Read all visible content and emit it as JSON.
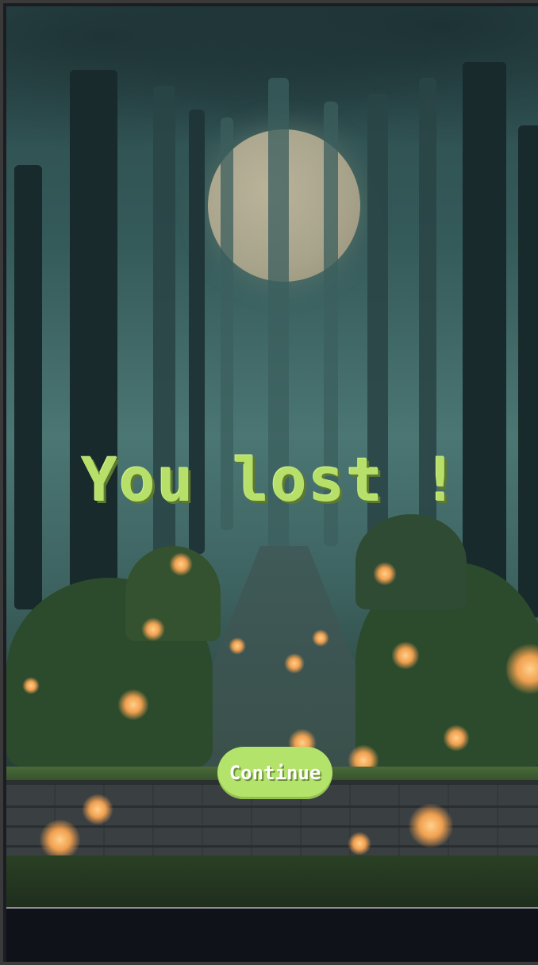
{
  "screen": {
    "title": "You lost !",
    "continue_label": "Continue"
  },
  "colors": {
    "title": "#b6e06a",
    "button_background": "#b3e36a",
    "button_text": "#ffffff",
    "moon": "#a8a38b",
    "base": "#0f1219"
  },
  "scene": {
    "background_name": "night-forest-background",
    "moon_name": "full-moon",
    "fireflies": "glowing-mushrooms-and-fireflies"
  }
}
